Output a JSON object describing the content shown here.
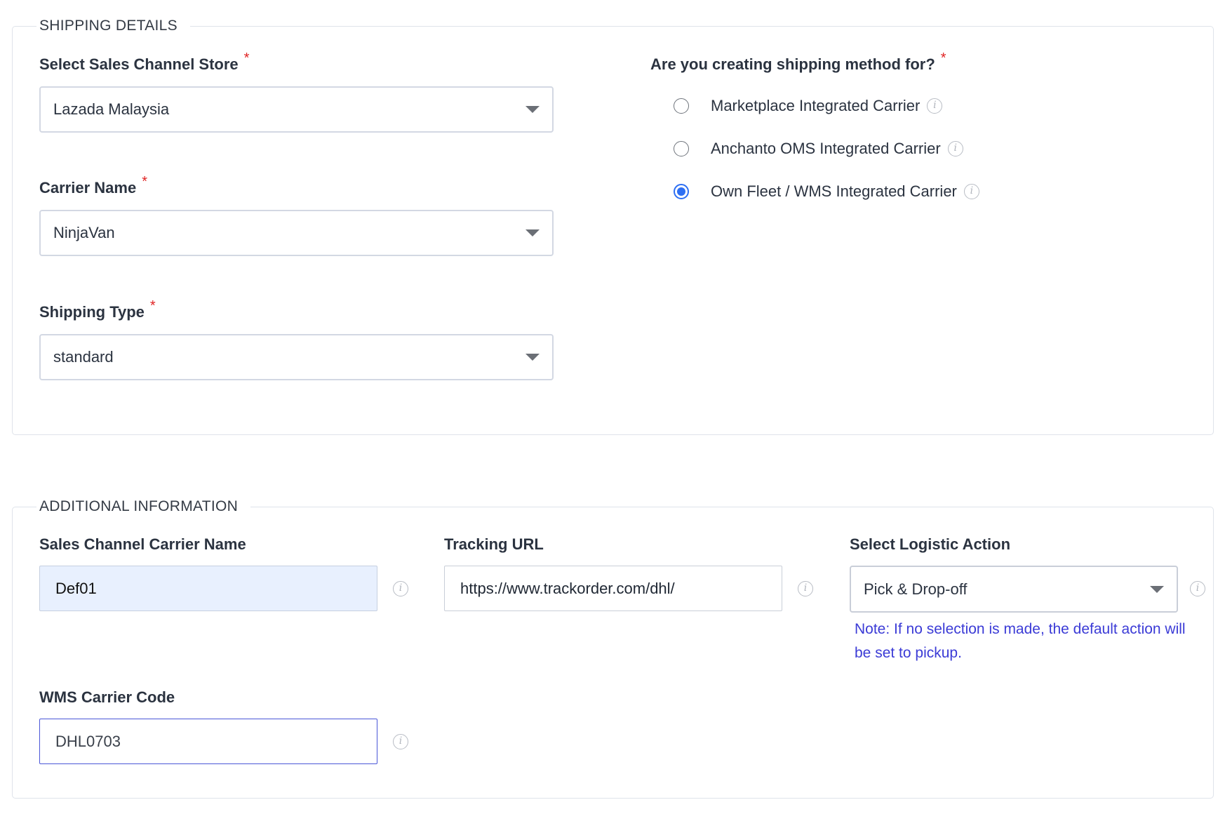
{
  "shipping_details": {
    "legend": "SHIPPING DETAILS",
    "store": {
      "label": "Select Sales Channel Store",
      "required": "*",
      "value": "Lazada Malaysia"
    },
    "carrier": {
      "label": "Carrier Name",
      "required": "*",
      "value": "NinjaVan"
    },
    "shipping_type": {
      "label": "Shipping Type",
      "required": "*",
      "value": "standard"
    },
    "method": {
      "label": "Are you creating shipping method for?",
      "required": "*",
      "options": [
        {
          "label": "Marketplace Integrated Carrier",
          "selected": false
        },
        {
          "label": "Anchanto OMS Integrated Carrier",
          "selected": false
        },
        {
          "label": "Own Fleet / WMS Integrated Carrier",
          "selected": true
        }
      ]
    }
  },
  "additional_information": {
    "legend": "ADDITIONAL INFORMATION",
    "sales_channel_carrier_name": {
      "label": "Sales Channel Carrier Name",
      "value": "Def01"
    },
    "tracking_url": {
      "label": "Tracking URL",
      "value": "https://www.trackorder.com/dhl/"
    },
    "logistic_action": {
      "label": "Select Logistic Action",
      "value": "Pick & Drop-off",
      "note": "Note: If no selection is made, the default action will be set to pickup."
    },
    "wms_carrier_code": {
      "label": "WMS Carrier Code",
      "value": "DHL0703"
    }
  },
  "icons": {
    "info": "info-icon",
    "dropdown": "caret-down-icon"
  },
  "colors": {
    "accent": "#2d6ff3",
    "required": "#e02424",
    "note": "#3b3bd6",
    "autofill": "#e8f0fe"
  }
}
